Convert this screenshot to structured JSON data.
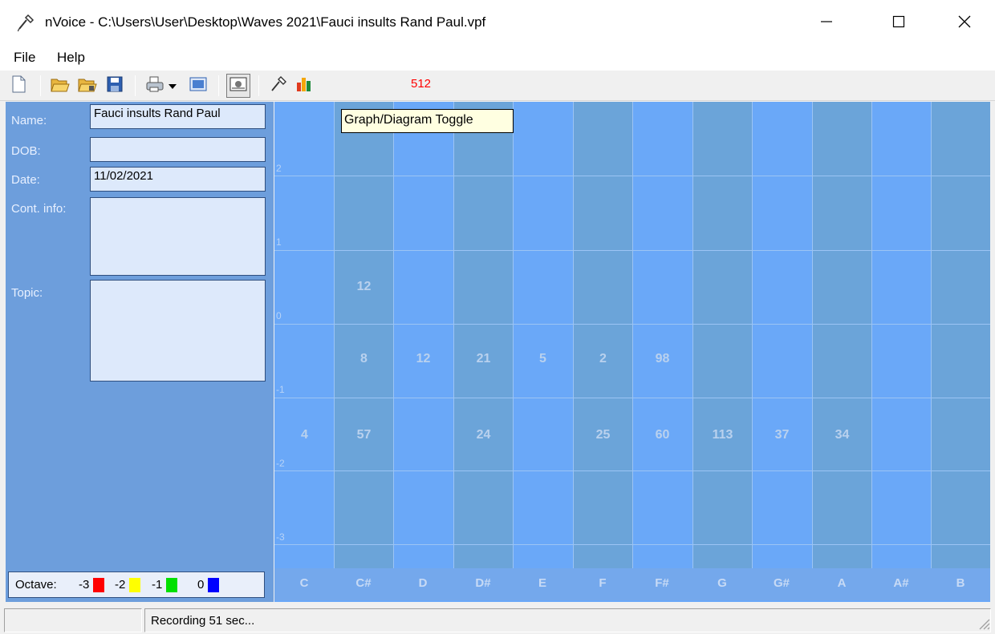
{
  "window": {
    "title": "nVoice - C:\\Users\\User\\Desktop\\Waves 2021\\Fauci insults Rand Paul.vpf"
  },
  "menu": {
    "file": "File",
    "help": "Help"
  },
  "toolbar": {
    "counter": "512"
  },
  "tooltip": "Graph/Diagram Toggle",
  "form": {
    "name_label": "Name:",
    "name_value": "Fauci insults Rand Paul",
    "dob_label": "DOB:",
    "dob_value": "",
    "date_label": "Date:",
    "date_value": "11/02/2021",
    "contact_label": "Cont. info:",
    "contact_value": "",
    "topic_label": "Topic:",
    "topic_value": ""
  },
  "octave_legend": {
    "label": "Octave:",
    "items": [
      {
        "label": "-3",
        "color": "#ff0000"
      },
      {
        "label": "-2",
        "color": "#ffff00"
      },
      {
        "label": "-1",
        "color": "#00e000"
      },
      {
        "label": "0",
        "color": "#0000ff"
      }
    ]
  },
  "diagram": {
    "notes": [
      "C",
      "C#",
      "D",
      "D#",
      "E",
      "F",
      "F#",
      "G",
      "G#",
      "A",
      "A#",
      "B"
    ],
    "row_labels": [
      "2",
      "1",
      "0",
      "-1",
      "-2",
      "-3"
    ],
    "values": [
      {
        "note": "C#",
        "row": "0",
        "value": "12"
      },
      {
        "note": "C#",
        "row": "-1",
        "value": "8"
      },
      {
        "note": "D",
        "row": "-1",
        "value": "12"
      },
      {
        "note": "D#",
        "row": "-1",
        "value": "21"
      },
      {
        "note": "E",
        "row": "-1",
        "value": "5"
      },
      {
        "note": "F",
        "row": "-1",
        "value": "2"
      },
      {
        "note": "F#",
        "row": "-1",
        "value": "98"
      },
      {
        "note": "C",
        "row": "-2",
        "value": "4"
      },
      {
        "note": "C#",
        "row": "-2",
        "value": "57"
      },
      {
        "note": "D#",
        "row": "-2",
        "value": "24"
      },
      {
        "note": "F",
        "row": "-2",
        "value": "25"
      },
      {
        "note": "F#",
        "row": "-2",
        "value": "60"
      },
      {
        "note": "G",
        "row": "-2",
        "value": "113"
      },
      {
        "note": "G#",
        "row": "-2",
        "value": "37"
      },
      {
        "note": "A",
        "row": "-2",
        "value": "34"
      }
    ]
  },
  "status": {
    "text": "Recording 51 sec..."
  }
}
